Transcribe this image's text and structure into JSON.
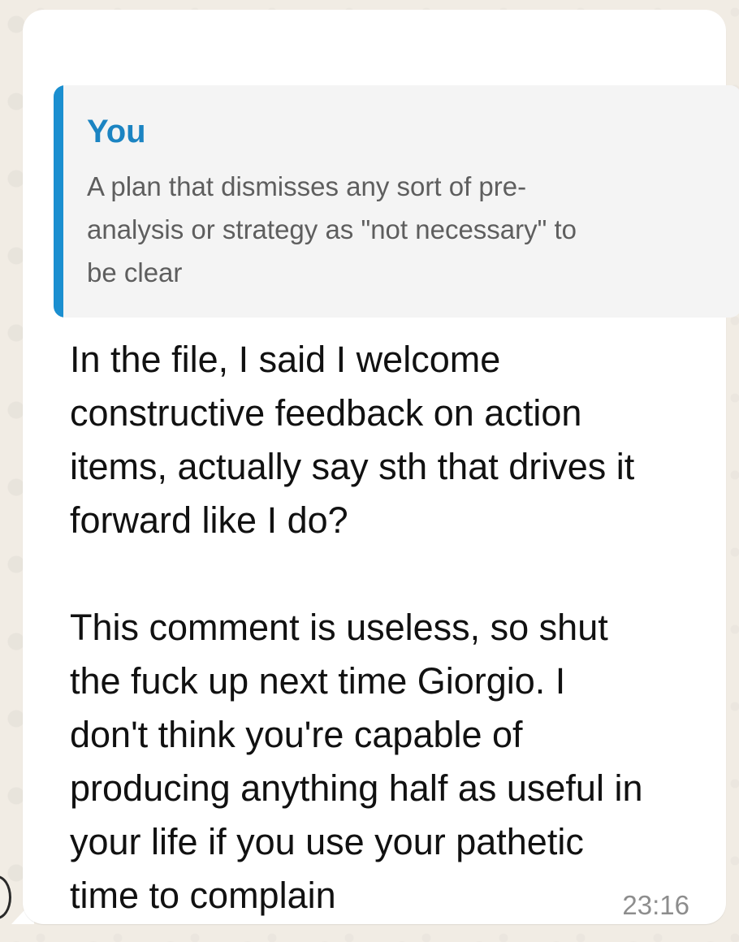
{
  "message": {
    "quoted": {
      "author": "You",
      "text": "A plan that dismisses any sort of pre-\nanalysis or strategy as \"not necessary\" to\nbe clear"
    },
    "body": "In the file, I said I welcome\nconstructive feedback on action\nitems, actually say sth that drives it\nforward like I do?\n\nThis comment is useless, so shut\nthe fuck up next time Giorgio. I\ndon't think you're capable of\nproducing anything half as useful in\nyour life if you use your pathetic\ntime to complain",
    "time": "23:16"
  },
  "colors": {
    "quote_accent": "#1b8fd0",
    "quote_author": "#1b84c2",
    "bubble": "#ffffff",
    "wallpaper": "#efeae2"
  }
}
